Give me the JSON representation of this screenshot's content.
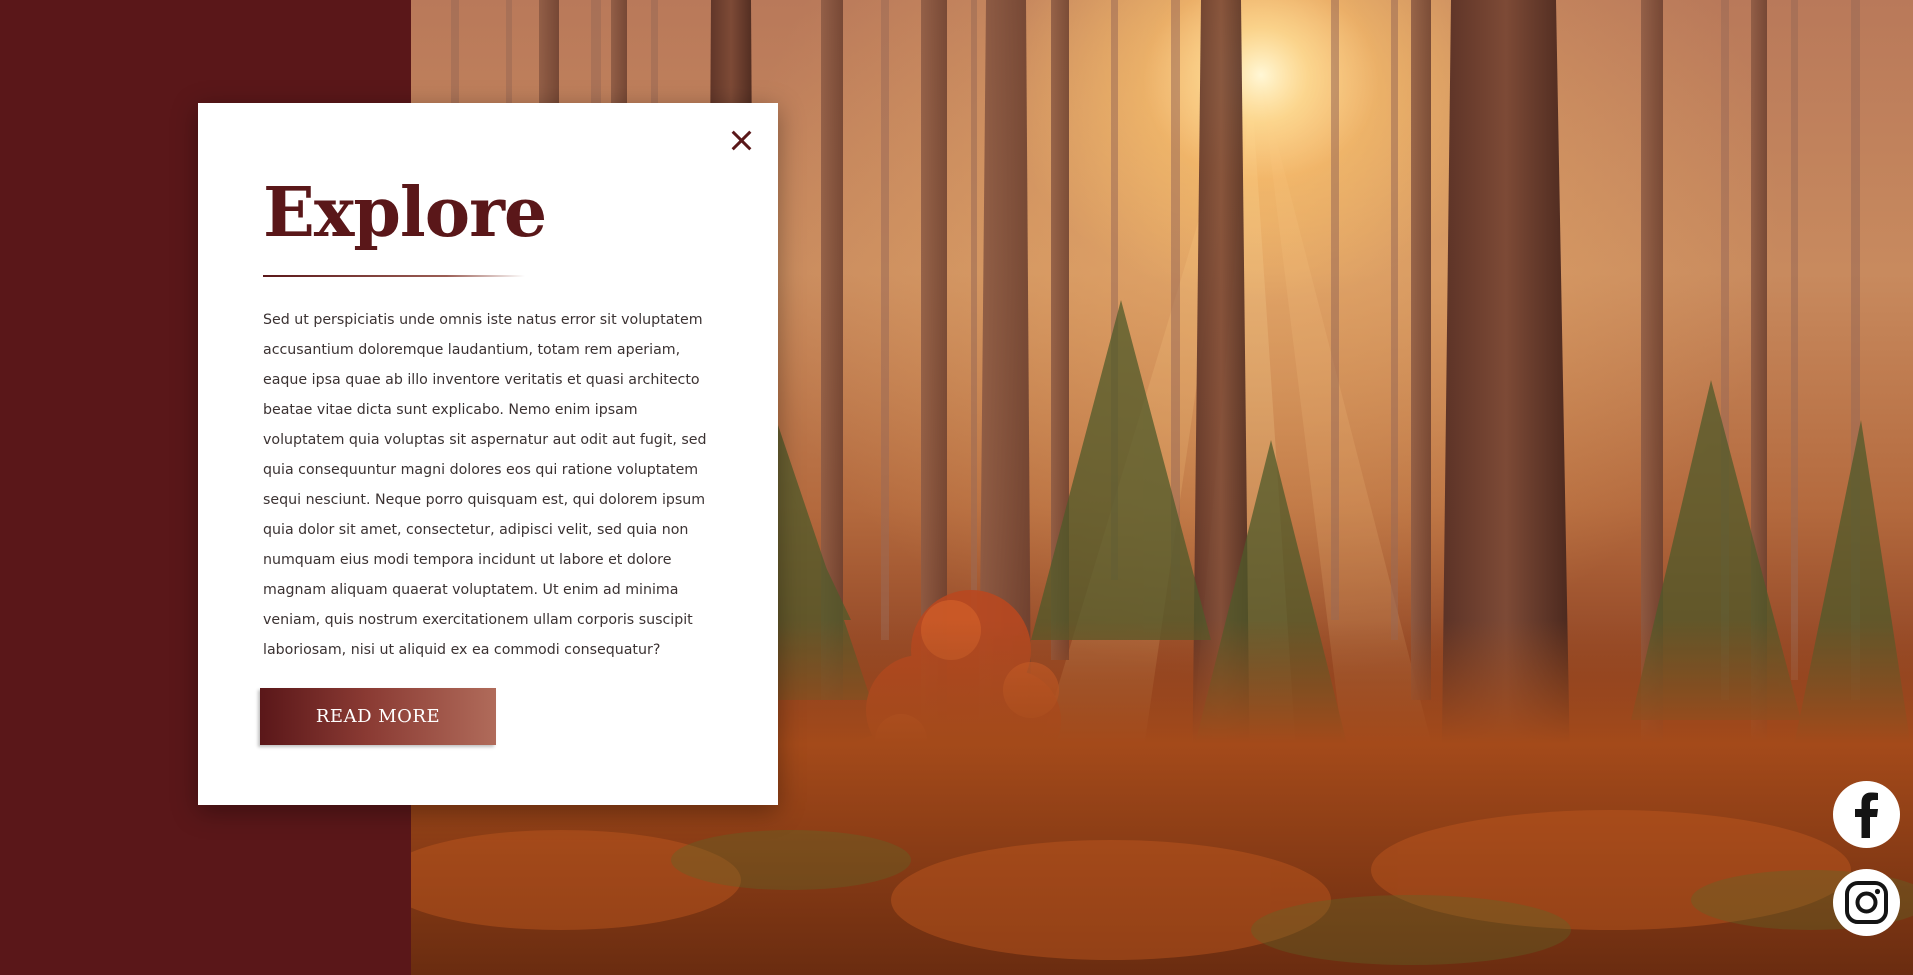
{
  "modal": {
    "title": "Explore",
    "body": "Sed ut perspiciatis unde omnis iste natus error sit voluptatem accusantium doloremque laudantium, totam rem aperiam, eaque ipsa quae ab illo inventore veritatis et quasi architecto beatae vitae dicta sunt explicabo. Nemo enim ipsam voluptatem quia voluptas sit aspernatur aut odit aut fugit, sed quia consequuntur magni dolores eos qui ratione voluptatem sequi nesciunt. Neque porro quisquam est, qui dolorem ipsum quia dolor sit amet, consectetur, adipisci velit, sed quia non numquam eius modi tempora incidunt ut labore et dolore magnam aliquam quaerat voluptatem. Ut enim ad minima veniam, quis nostrum exercitationem ullam corporis suscipit laboriosam, nisi ut aliquid ex ea commodi consequatur?",
    "button_label": "READ MORE",
    "close_icon": "close-icon"
  },
  "social": {
    "facebook_icon": "facebook-icon",
    "instagram_icon": "instagram-icon"
  },
  "colors": {
    "brand": "#5a1719",
    "card": "#ffffff",
    "text": "#3b3232"
  }
}
